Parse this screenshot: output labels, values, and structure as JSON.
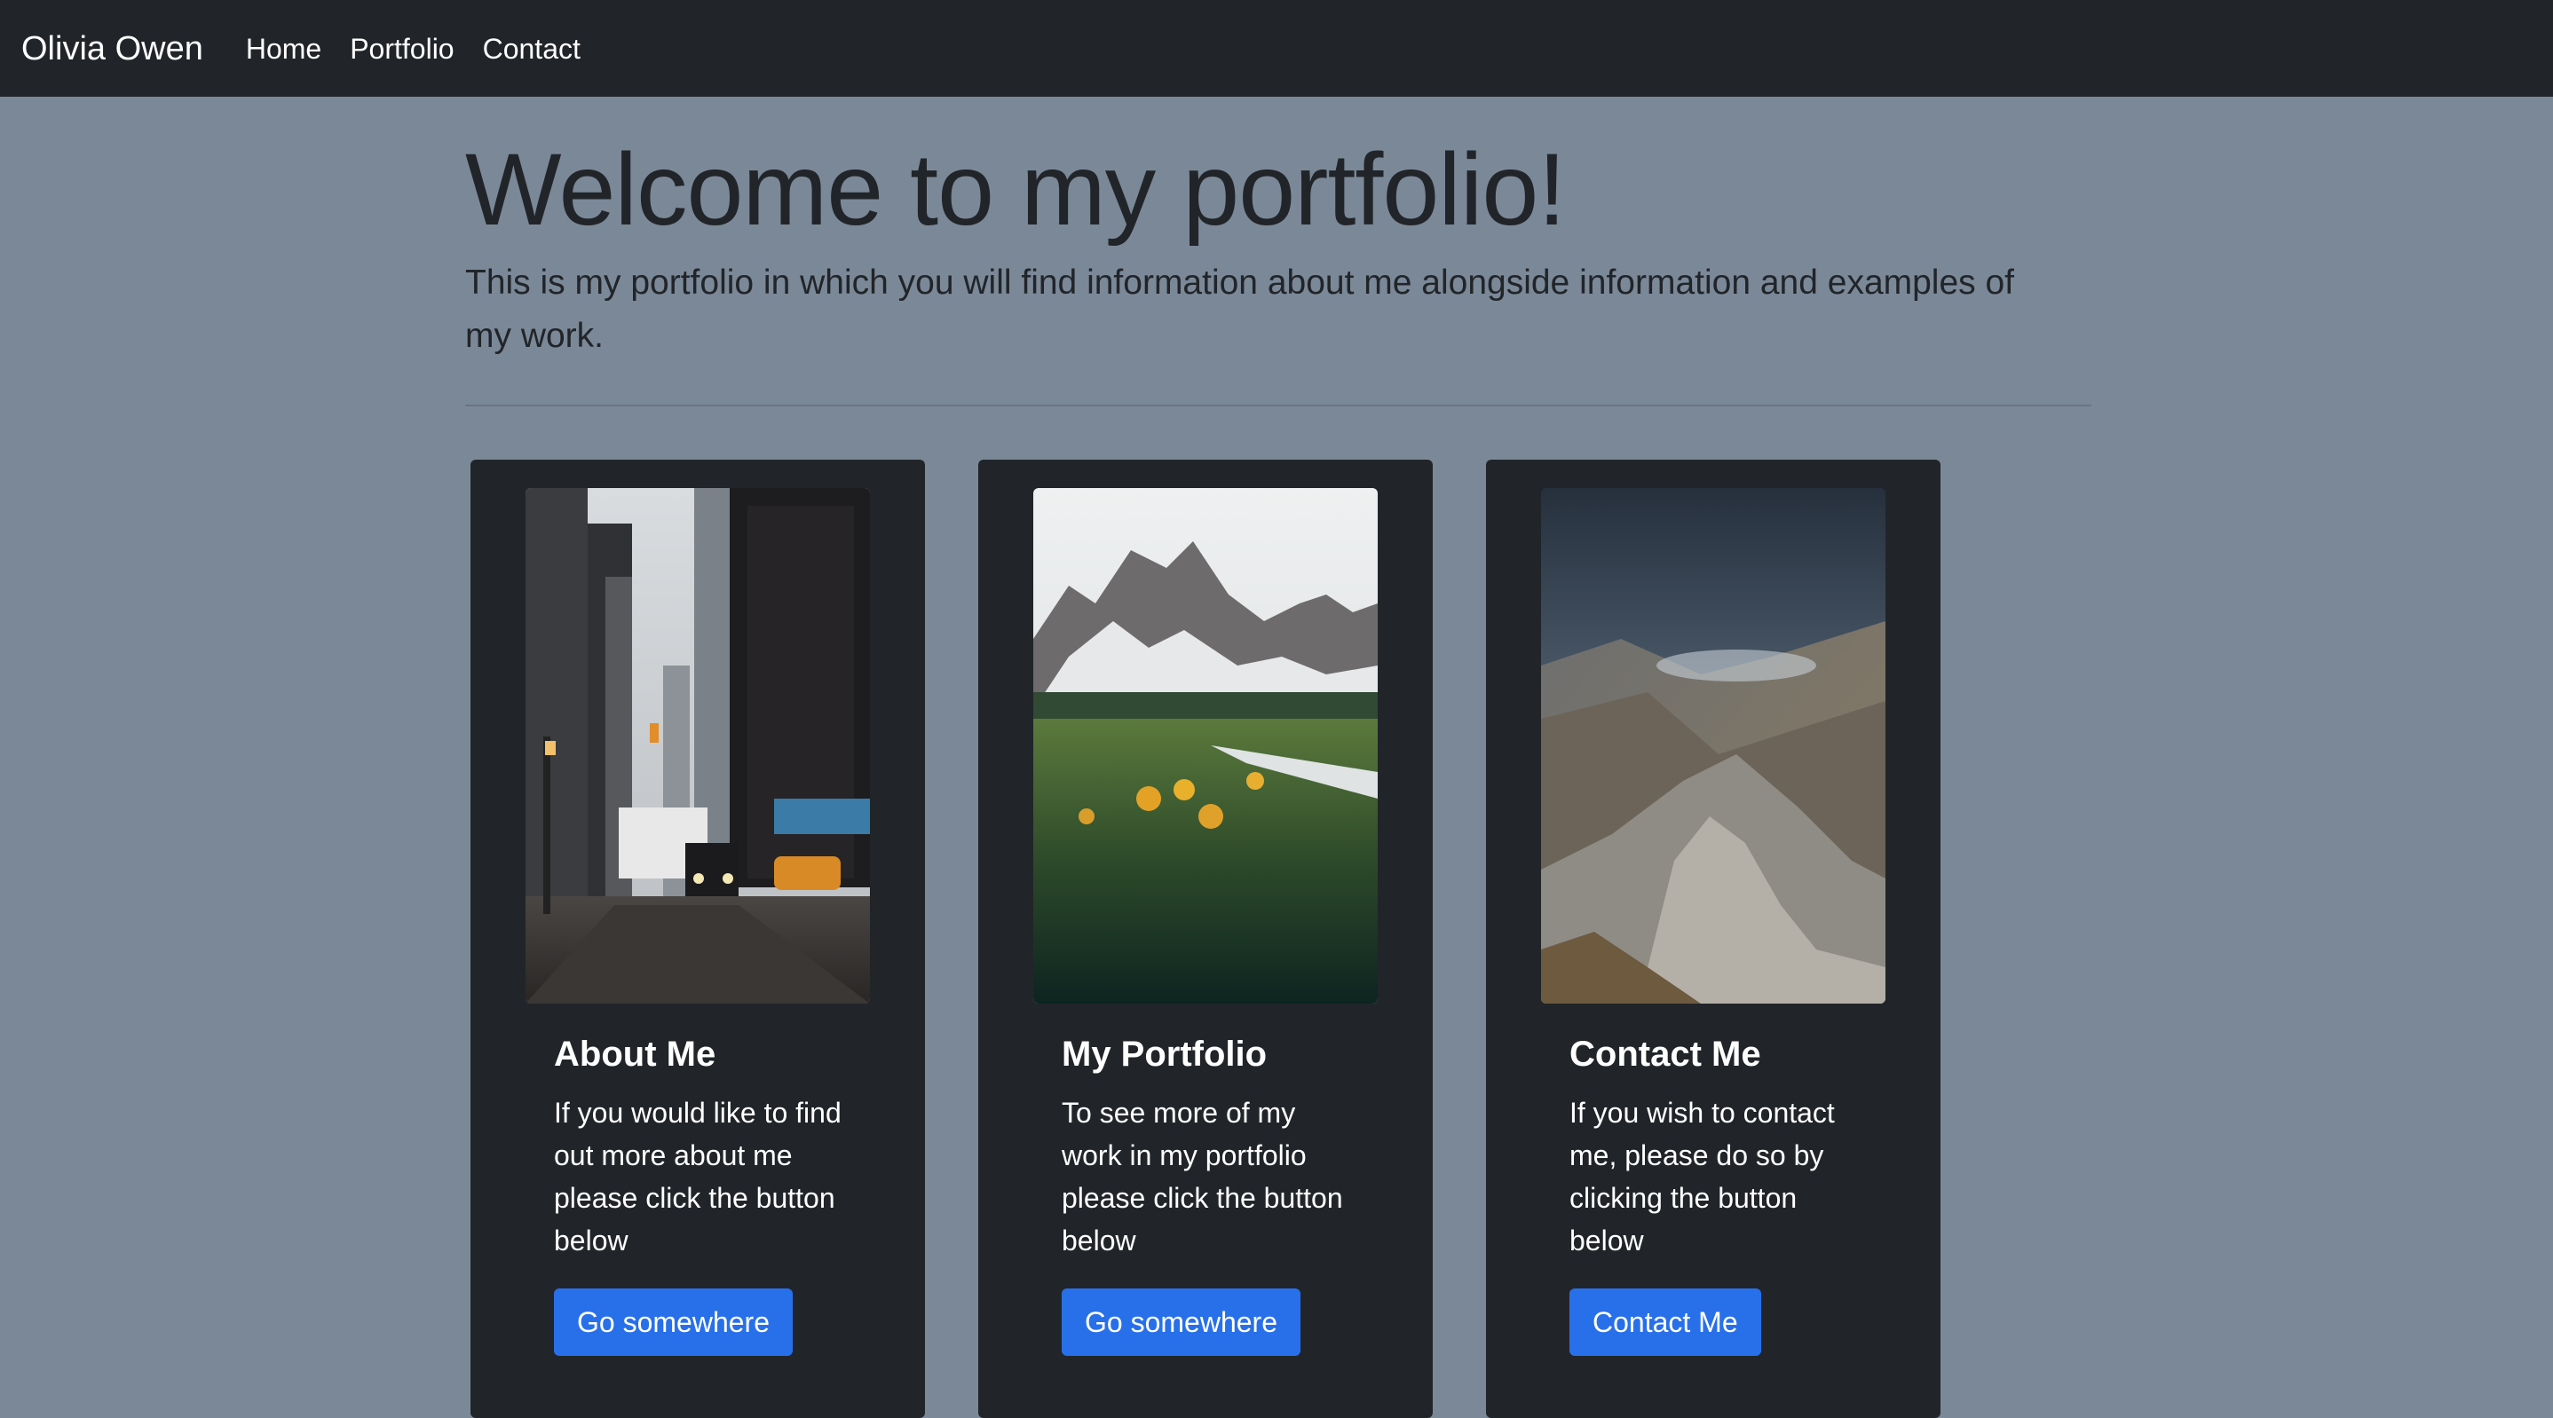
{
  "navbar": {
    "brand": "Olivia Owen",
    "links": [
      "Home",
      "Portfolio",
      "Contact"
    ]
  },
  "jumbotron": {
    "title": "Welcome to my portfolio!",
    "lead": "This is my portfolio in which you will find information about me alongside information and examples of my work."
  },
  "cards": [
    {
      "image": "city-street-photo",
      "title": "About Me",
      "text": "If you would like to find out more about me please click the button below",
      "button": "Go somewhere"
    },
    {
      "image": "mountain-meadow-photo",
      "title": "My Portfolio",
      "text": "To see more of my work in my portfolio please click the button below",
      "button": "Go somewhere"
    },
    {
      "image": "rocky-mountain-valley-photo",
      "title": "Contact Me",
      "text": "If you wish to contact me, please do so by clicking the button below",
      "button": "Contact Me"
    }
  ],
  "colors": {
    "page_background": "#7b8898",
    "navbar_background": "#212529",
    "card_background": "#212529",
    "button_primary": "#2870ea",
    "text_dark": "#212529",
    "text_light": "#ffffff"
  }
}
